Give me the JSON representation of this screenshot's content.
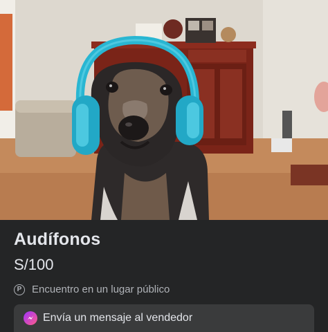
{
  "listing": {
    "title": "Audífonos",
    "price": "S/100",
    "pickup_text": "Encuentro en un lugar público",
    "pickup_icon_glyph": "P"
  },
  "message_card": {
    "label": "Envía un mensaje al vendedor",
    "icon": "messenger-icon"
  },
  "colors": {
    "background": "#242526",
    "card": "#3a3b3c",
    "headphones": "#29b6d2"
  }
}
